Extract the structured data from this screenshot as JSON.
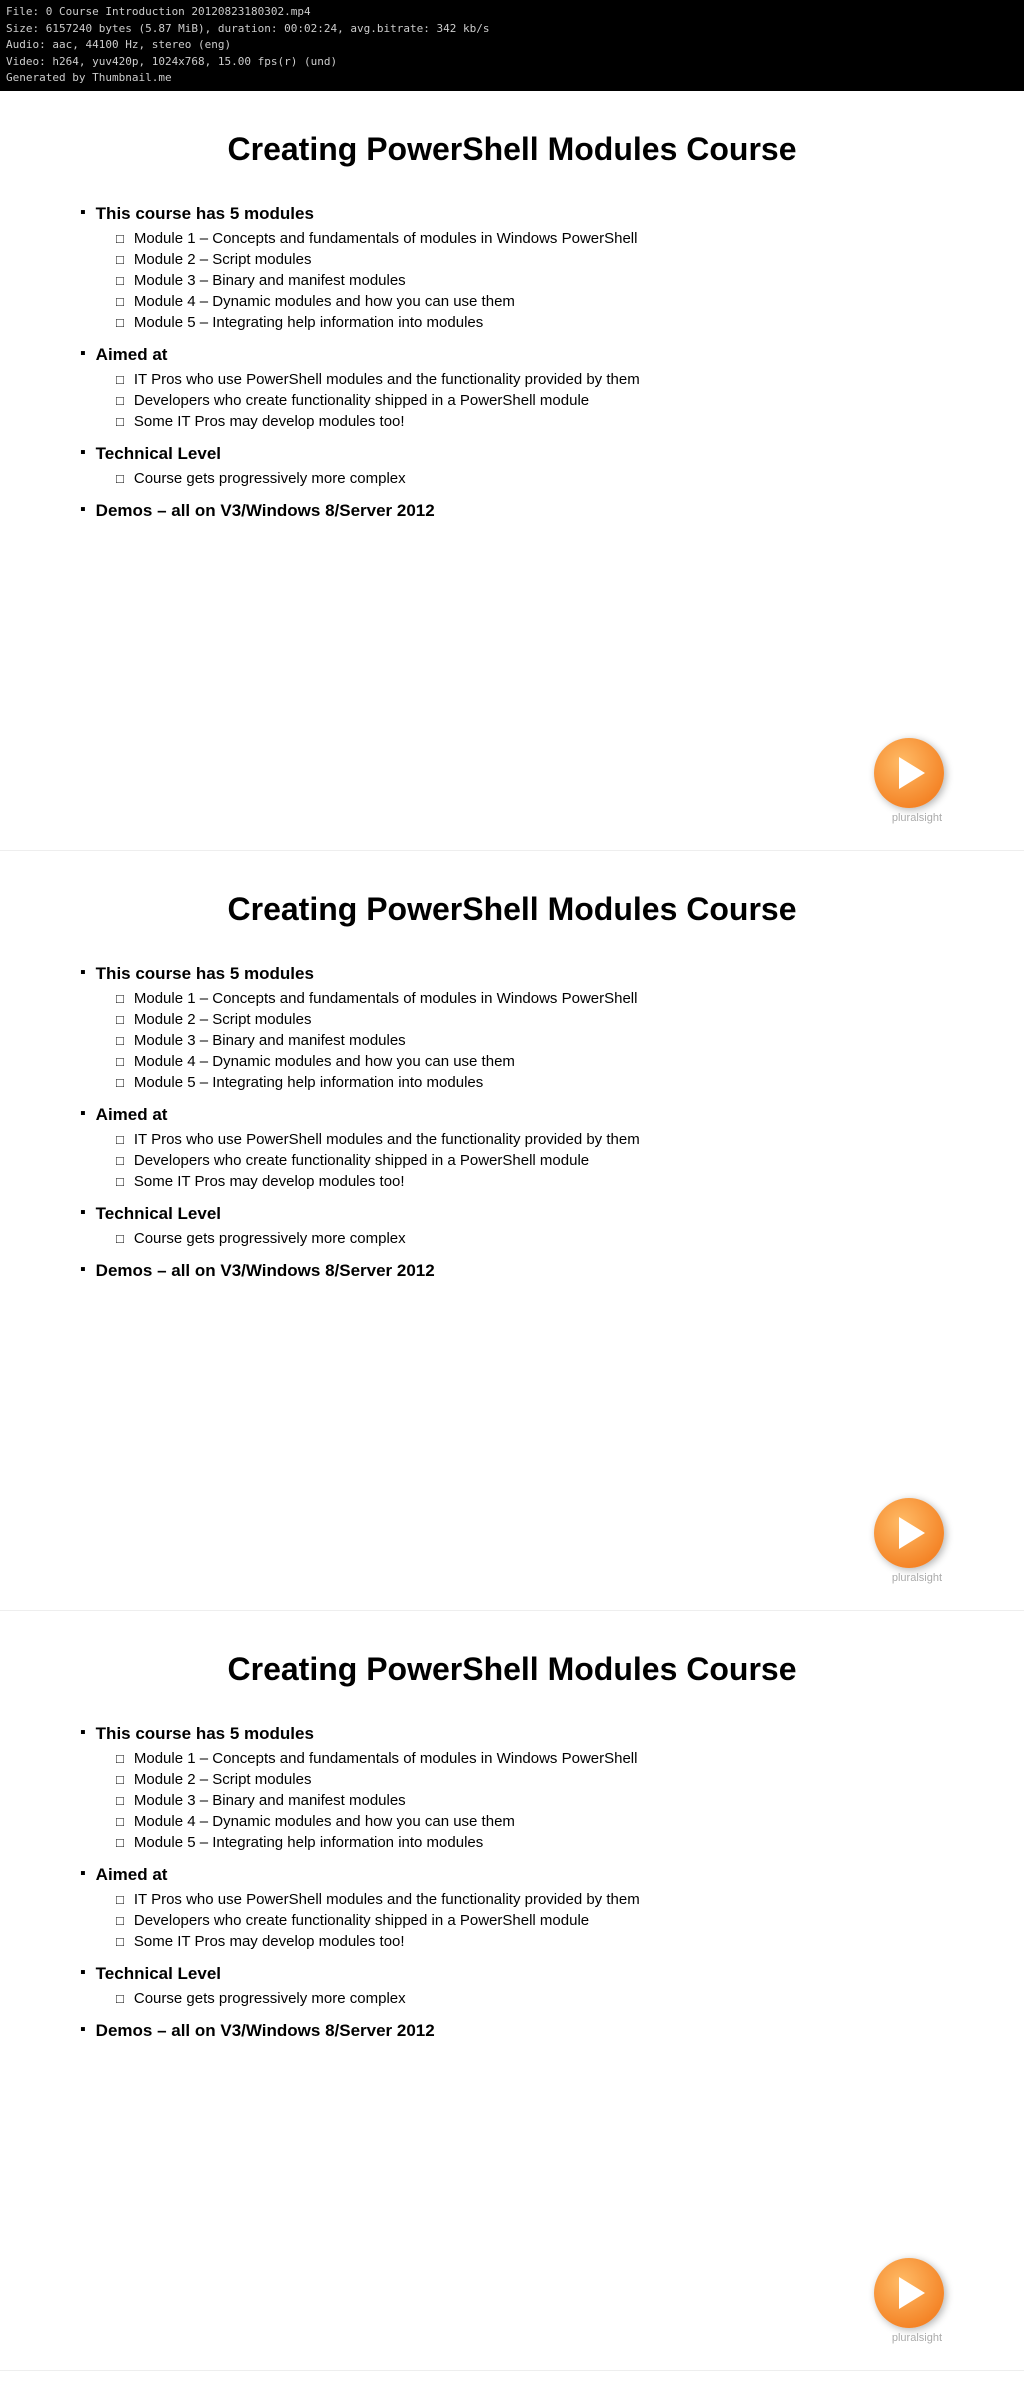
{
  "topbar": {
    "line1": "File: 0 Course Introduction 20120823180302.mp4",
    "line2": "Size: 6157240 bytes (5.87 MiB), duration: 00:02:24, avg.bitrate: 342 kb/s",
    "line3": "Audio: aac, 44100 Hz, stereo (eng)",
    "line4": "Video: h264, yuv420p, 1024x768, 15.00 fps(r) (und)",
    "line5": "Generated by Thumbnail.me"
  },
  "slides": [
    {
      "title": "Creating PowerShell Modules Course",
      "sections": [
        {
          "label": "This course has 5 modules",
          "items": [
            "Module 1 – Concepts and fundamentals of modules in Windows PowerShell",
            "Module 2 – Script modules",
            "Module 3 – Binary and manifest modules",
            "Module 4 – Dynamic modules and how you can use them",
            "Module 5 – Integrating help information into modules"
          ]
        },
        {
          "label": "Aimed at",
          "items": [
            "IT Pros who use PowerShell modules and the functionality provided by them",
            "Developers who create functionality shipped in a PowerShell module",
            "Some IT Pros may develop modules too!"
          ]
        },
        {
          "label": "Technical Level",
          "items": [
            "Course gets progressively more complex"
          ]
        },
        {
          "label": "Demos – all on V3/Windows 8/Server 2012",
          "items": []
        }
      ]
    },
    {
      "title": "Creating PowerShell Modules Course",
      "sections": [
        {
          "label": "This course has 5 modules",
          "items": [
            "Module 1 – Concepts and fundamentals of modules in Windows PowerShell",
            "Module 2 – Script modules",
            "Module 3 – Binary and manifest modules",
            "Module 4 – Dynamic modules and how you can use them",
            "Module 5 – Integrating help information into modules"
          ]
        },
        {
          "label": "Aimed at",
          "items": [
            "IT Pros who use PowerShell modules and the functionality provided by them",
            "Developers who create functionality shipped in a PowerShell module",
            "Some IT Pros may develop modules too!"
          ]
        },
        {
          "label": "Technical Level",
          "items": [
            "Course gets progressively more complex"
          ]
        },
        {
          "label": "Demos – all on V3/Windows 8/Server 2012",
          "items": []
        }
      ]
    },
    {
      "title": "Creating PowerShell Modules Course",
      "sections": [
        {
          "label": "This course has 5 modules",
          "items": [
            "Module 1 – Concepts and fundamentals of modules in Windows PowerShell",
            "Module 2 – Script modules",
            "Module 3 – Binary and manifest modules",
            "Module 4 – Dynamic modules and how you can use them",
            "Module 5 – Integrating help information into modules"
          ]
        },
        {
          "label": "Aimed at",
          "items": [
            "IT Pros who use PowerShell modules and the functionality provided by them",
            "Developers who create functionality shipped in a PowerShell module",
            "Some IT Pros may develop modules too!"
          ]
        },
        {
          "label": "Technical Level",
          "items": [
            "Course gets progressively more complex"
          ]
        },
        {
          "label": "Demos – all on V3/Windows 8/Server 2012",
          "items": []
        }
      ]
    }
  ],
  "pluralsight_label": "pluralsight"
}
